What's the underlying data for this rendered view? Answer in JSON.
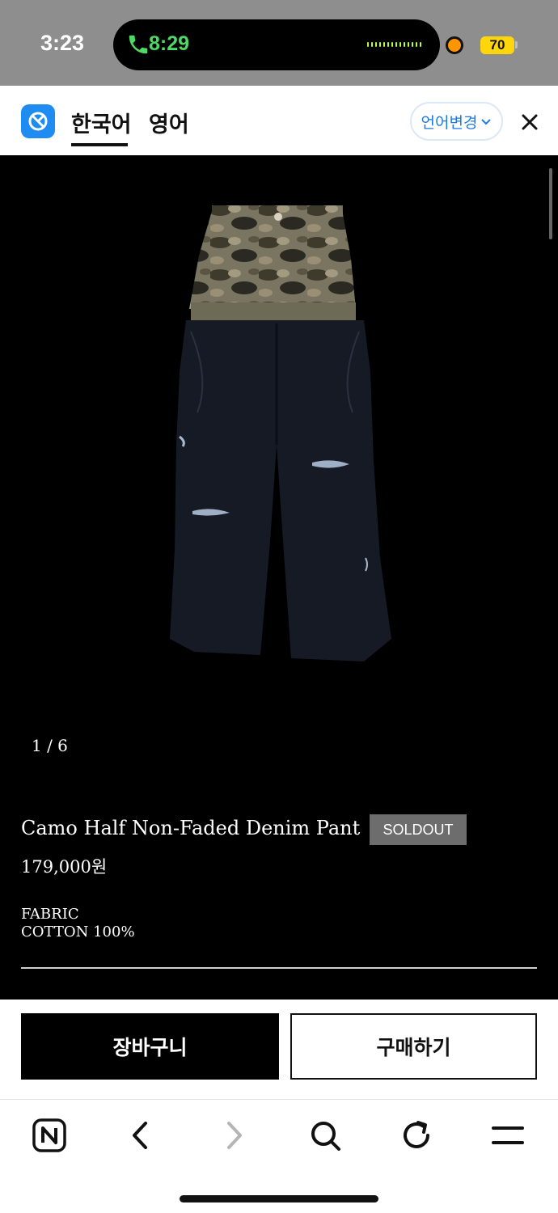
{
  "status_bar": {
    "time": "3:23",
    "call_time": "8:29",
    "battery": "70"
  },
  "translate_bar": {
    "tabs": [
      "한국어",
      "영어"
    ],
    "active_tab": "한국어",
    "change_language_label": "언어변경"
  },
  "product": {
    "image_counter": "1 / 6",
    "title": "Camo Half Non-Faded Denim Pant",
    "status_badge": "SOLDOUT",
    "price": "179,000원",
    "fabric_label": "FABRIC",
    "fabric_value": "COTTON 100%"
  },
  "actions": {
    "cart_label": "장바구니",
    "buy_label": "구매하기"
  },
  "toolbar": {
    "icons": [
      "naver-home-icon",
      "back-icon",
      "forward-icon",
      "search-icon",
      "refresh-icon",
      "menu-icon"
    ]
  },
  "colors": {
    "status_bar_bg": "#8e8e8e",
    "accent_blue": "#1e7ae0",
    "soldout_badge": "#6d6d6d",
    "call_green": "#4cd964",
    "battery_yellow": "#ffd60a"
  }
}
